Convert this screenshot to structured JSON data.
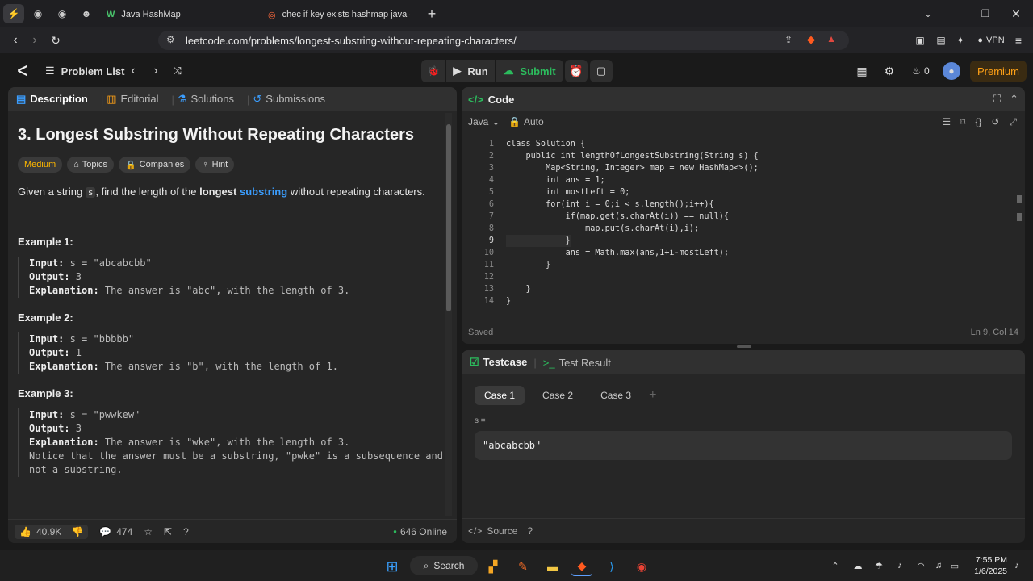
{
  "browser": {
    "tabs": [
      {
        "label": "Java HashMap"
      },
      {
        "label": "chec if key exists hashmap java - Br"
      }
    ],
    "url": "leetcode.com/problems/longest-substring-without-repeating-characters/",
    "vpn_label": "VPN"
  },
  "nav": {
    "problem_list": "Problem List",
    "run": "Run",
    "submit": "Submit",
    "streak_count": "0",
    "premium": "Premium"
  },
  "left": {
    "tabs": [
      "Description",
      "Editorial",
      "Solutions",
      "Submissions"
    ],
    "title": "3. Longest Substring Without Repeating Characters",
    "difficulty": "Medium",
    "chips": [
      "Topics",
      "Companies",
      "Hint"
    ],
    "statement": {
      "p1": "Given a string ",
      "code": "s",
      "p2": ", find the length of the ",
      "bold": "longest",
      "link": "substring",
      "p3": " without repeating characters."
    },
    "examples": [
      {
        "title": "Example 1:",
        "input_label": "Input:",
        "input": " s = \"abcabcbb\"",
        "output_label": "Output:",
        "output": " 3",
        "expl_label": "Explanation:",
        "expl": " The answer is \"abc\", with the length of 3.",
        "extra1": "",
        "extra2": ""
      },
      {
        "title": "Example 2:",
        "input_label": "Input:",
        "input": " s = \"bbbbb\"",
        "output_label": "Output:",
        "output": " 1",
        "expl_label": "Explanation:",
        "expl": " The answer is \"b\", with the length of 1.",
        "extra1": "",
        "extra2": ""
      },
      {
        "title": "Example 3:",
        "input_label": "Input:",
        "input": " s = \"pwwkew\"",
        "output_label": "Output:",
        "output": " 3",
        "expl_label": "Explanation:",
        "expl": " The answer is \"wke\", with the length of 3.",
        "extra1": "Notice that the answer must be a substring, \"pwke\" is a subsequence and",
        "extra2": "not a substring."
      }
    ],
    "footer": {
      "likes": "40.9K",
      "comments": "474",
      "online": "646 Online"
    }
  },
  "code": {
    "header": "Code",
    "language": "Java",
    "mode": "Auto",
    "lines": [
      "class Solution {",
      "    public int lengthOfLongestSubstring(String s) {",
      "        Map<String, Integer> map = new HashMap<>();",
      "        int ans = 1;",
      "        int mostLeft = 0;",
      "        for(int i = 0;i < s.length();i++){",
      "            if(map.get(s.charAt(i)) == null){",
      "                map.put(s.charAt(i),i);",
      "            }",
      "            ans = Math.max(ans,1+i-mostLeft);",
      "        }",
      "",
      "    }",
      "}"
    ],
    "status": "Saved",
    "cursor": "Ln 9, Col 14"
  },
  "testcase": {
    "tabs": [
      "Testcase",
      "Test Result"
    ],
    "cases": [
      "Case 1",
      "Case 2",
      "Case 3"
    ],
    "var_label": "s =",
    "value": "\"abcabcbb\"",
    "source": "Source"
  },
  "taskbar": {
    "search": "Search",
    "time": "7:55 PM",
    "date": "1/6/2025"
  },
  "colors": {
    "accent_orange": "#ffa116",
    "submit_green": "#2cbb5d",
    "link_blue": "#3b9eff",
    "medium_yellow": "#ffb800"
  }
}
